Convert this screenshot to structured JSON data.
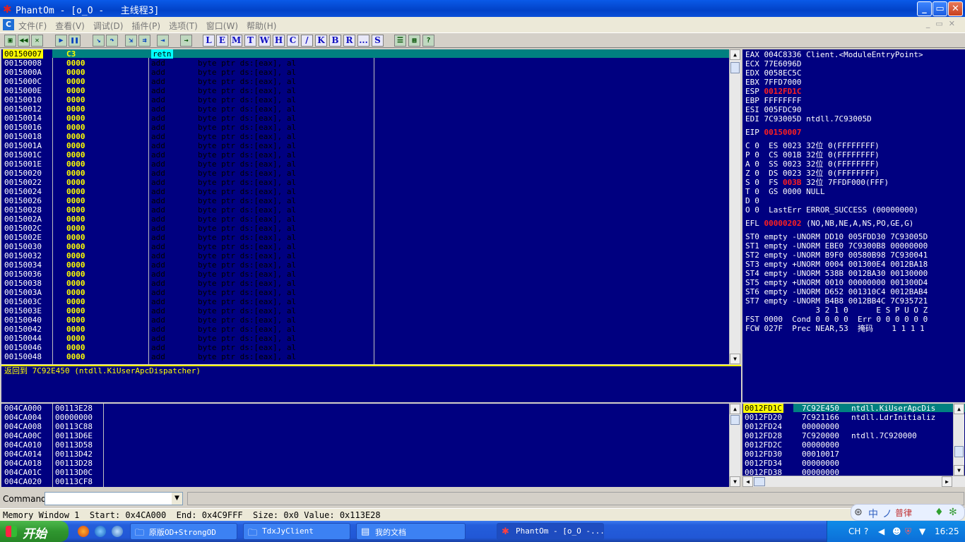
{
  "window": {
    "title": "PhantOm - [o_O -   主线程3]",
    "controls": [
      "_",
      "▭",
      "✕"
    ]
  },
  "menu": {
    "items": [
      "文件(F)",
      "查看(V)",
      "调试(D)",
      "插件(P)",
      "选项(T)",
      "窗口(W)",
      "帮助(H)"
    ]
  },
  "toolbar": {
    "letters": [
      "L",
      "E",
      "M",
      "T",
      "W",
      "H",
      "C",
      "/",
      "K",
      "B",
      "R",
      "...",
      "S"
    ]
  },
  "disasm": {
    "rows": [
      {
        "addr": "00150007",
        "hex": "C3",
        "mnemonic": "retn",
        "operand": ""
      },
      {
        "addr": "00150008",
        "hex": "0000",
        "mnemonic": "add",
        "operand": "byte ptr ds:[eax], al"
      },
      {
        "addr": "0015000A",
        "hex": "0000",
        "mnemonic": "add",
        "operand": "byte ptr ds:[eax], al"
      },
      {
        "addr": "0015000C",
        "hex": "0000",
        "mnemonic": "add",
        "operand": "byte ptr ds:[eax], al"
      },
      {
        "addr": "0015000E",
        "hex": "0000",
        "mnemonic": "add",
        "operand": "byte ptr ds:[eax], al"
      },
      {
        "addr": "00150010",
        "hex": "0000",
        "mnemonic": "add",
        "operand": "byte ptr ds:[eax], al"
      },
      {
        "addr": "00150012",
        "hex": "0000",
        "mnemonic": "add",
        "operand": "byte ptr ds:[eax], al"
      },
      {
        "addr": "00150014",
        "hex": "0000",
        "mnemonic": "add",
        "operand": "byte ptr ds:[eax], al"
      },
      {
        "addr": "00150016",
        "hex": "0000",
        "mnemonic": "add",
        "operand": "byte ptr ds:[eax], al"
      },
      {
        "addr": "00150018",
        "hex": "0000",
        "mnemonic": "add",
        "operand": "byte ptr ds:[eax], al"
      },
      {
        "addr": "0015001A",
        "hex": "0000",
        "mnemonic": "add",
        "operand": "byte ptr ds:[eax], al"
      },
      {
        "addr": "0015001C",
        "hex": "0000",
        "mnemonic": "add",
        "operand": "byte ptr ds:[eax], al"
      },
      {
        "addr": "0015001E",
        "hex": "0000",
        "mnemonic": "add",
        "operand": "byte ptr ds:[eax], al"
      },
      {
        "addr": "00150020",
        "hex": "0000",
        "mnemonic": "add",
        "operand": "byte ptr ds:[eax], al"
      },
      {
        "addr": "00150022",
        "hex": "0000",
        "mnemonic": "add",
        "operand": "byte ptr ds:[eax], al"
      },
      {
        "addr": "00150024",
        "hex": "0000",
        "mnemonic": "add",
        "operand": "byte ptr ds:[eax], al"
      },
      {
        "addr": "00150026",
        "hex": "0000",
        "mnemonic": "add",
        "operand": "byte ptr ds:[eax], al"
      },
      {
        "addr": "00150028",
        "hex": "0000",
        "mnemonic": "add",
        "operand": "byte ptr ds:[eax], al"
      },
      {
        "addr": "0015002A",
        "hex": "0000",
        "mnemonic": "add",
        "operand": "byte ptr ds:[eax], al"
      },
      {
        "addr": "0015002C",
        "hex": "0000",
        "mnemonic": "add",
        "operand": "byte ptr ds:[eax], al"
      },
      {
        "addr": "0015002E",
        "hex": "0000",
        "mnemonic": "add",
        "operand": "byte ptr ds:[eax], al"
      },
      {
        "addr": "00150030",
        "hex": "0000",
        "mnemonic": "add",
        "operand": "byte ptr ds:[eax], al"
      },
      {
        "addr": "00150032",
        "hex": "0000",
        "mnemonic": "add",
        "operand": "byte ptr ds:[eax], al"
      },
      {
        "addr": "00150034",
        "hex": "0000",
        "mnemonic": "add",
        "operand": "byte ptr ds:[eax], al"
      },
      {
        "addr": "00150036",
        "hex": "0000",
        "mnemonic": "add",
        "operand": "byte ptr ds:[eax], al"
      },
      {
        "addr": "00150038",
        "hex": "0000",
        "mnemonic": "add",
        "operand": "byte ptr ds:[eax], al"
      },
      {
        "addr": "0015003A",
        "hex": "0000",
        "mnemonic": "add",
        "operand": "byte ptr ds:[eax], al"
      },
      {
        "addr": "0015003C",
        "hex": "0000",
        "mnemonic": "add",
        "operand": "byte ptr ds:[eax], al"
      },
      {
        "addr": "0015003E",
        "hex": "0000",
        "mnemonic": "add",
        "operand": "byte ptr ds:[eax], al"
      },
      {
        "addr": "00150040",
        "hex": "0000",
        "mnemonic": "add",
        "operand": "byte ptr ds:[eax], al"
      },
      {
        "addr": "00150042",
        "hex": "0000",
        "mnemonic": "add",
        "operand": "byte ptr ds:[eax], al"
      },
      {
        "addr": "00150044",
        "hex": "0000",
        "mnemonic": "add",
        "operand": "byte ptr ds:[eax], al"
      },
      {
        "addr": "00150046",
        "hex": "0000",
        "mnemonic": "add",
        "operand": "byte ptr ds:[eax], al"
      },
      {
        "addr": "00150048",
        "hex": "0000",
        "mnemonic": "add",
        "operand": "byte ptr ds:[eax], al"
      }
    ]
  },
  "info": {
    "text": "返回到 7C92E450 (ntdll.KiUserApcDispatcher)"
  },
  "registers": {
    "lines": [
      {
        "t": "EAX 004C8336 Client.<ModuleEntryPoint>",
        "hl": ""
      },
      {
        "t": "ECX 77E6096D",
        "hl": ""
      },
      {
        "t": "EDX 0058EC5C",
        "hl": ""
      },
      {
        "t": "EBX 7FFD7000",
        "hl": ""
      },
      {
        "t": "ESP ",
        "hl": "0012FD1C"
      },
      {
        "t": "EBP FFFFFFFF",
        "hl": ""
      },
      {
        "t": "ESI 005FDC90",
        "hl": ""
      },
      {
        "t": "EDI 7C93005D ntdll.7C93005D",
        "hl": ""
      },
      {
        "t": "",
        "hl": ""
      },
      {
        "t": "EIP ",
        "hl": "00150007"
      },
      {
        "t": "",
        "hl": ""
      },
      {
        "t": "C 0  ES 0023 32位 0(FFFFFFFF)",
        "hl": ""
      },
      {
        "t": "P 0  CS 001B 32位 0(FFFFFFFF)",
        "hl": ""
      },
      {
        "t": "A 0  SS 0023 32位 0(FFFFFFFF)",
        "hl": ""
      },
      {
        "t": "Z 0  DS 0023 32位 0(FFFFFFFF)",
        "hl": ""
      },
      {
        "t": "S 0  FS ",
        "hl": "003B",
        "after": " 32位 7FFDF000(FFF)"
      },
      {
        "t": "T 0  GS 0000 NULL",
        "hl": ""
      },
      {
        "t": "D 0",
        "hl": ""
      },
      {
        "t": "O 0  LastErr ERROR_SUCCESS (00000000)",
        "hl": ""
      },
      {
        "t": "",
        "hl": ""
      },
      {
        "t": "EFL ",
        "hl": "00000202",
        "after": " (NO,NB,NE,A,NS,PO,GE,G)"
      },
      {
        "t": "",
        "hl": ""
      },
      {
        "t": "ST0 empty -UNORM DD10 005FDD30 7C93005D",
        "hl": ""
      },
      {
        "t": "ST1 empty -UNORM EBE0 7C9300B8 00000000",
        "hl": ""
      },
      {
        "t": "ST2 empty -UNORM B9F0 00580B98 7C930041",
        "hl": ""
      },
      {
        "t": "ST3 empty +UNORM 0004 001300E4 0012BA18",
        "hl": ""
      },
      {
        "t": "ST4 empty -UNORM 538B 0012BA30 00130000",
        "hl": ""
      },
      {
        "t": "ST5 empty +UNORM 0010 00000000 001300D4",
        "hl": ""
      },
      {
        "t": "ST6 empty -UNORM D652 001310C4 0012BAB4",
        "hl": ""
      },
      {
        "t": "ST7 empty -UNORM B4B8 0012BB4C 7C935721",
        "hl": ""
      },
      {
        "t": "               3 2 1 0      E S P U O Z",
        "hl": ""
      },
      {
        "t": "FST 0000  Cond 0 0 0 0  Err 0 0 0 0 0 0",
        "hl": ""
      },
      {
        "t": "FCW 027F  Prec NEAR,53  掩码    1 1 1 1",
        "hl": ""
      }
    ]
  },
  "dump": {
    "rows": [
      {
        "addr": "004CA000",
        "val": "00113E28"
      },
      {
        "addr": "004CA004",
        "val": "00000000"
      },
      {
        "addr": "004CA008",
        "val": "00113C88"
      },
      {
        "addr": "004CA00C",
        "val": "00113D6E"
      },
      {
        "addr": "004CA010",
        "val": "00113D58"
      },
      {
        "addr": "004CA014",
        "val": "00113D42"
      },
      {
        "addr": "004CA018",
        "val": "00113D28"
      },
      {
        "addr": "004CA01C",
        "val": "00113D0C"
      },
      {
        "addr": "004CA020",
        "val": "00113CF8"
      }
    ]
  },
  "stack": {
    "rows": [
      {
        "addr": "0012FD1C",
        "val": "7C92E450",
        "cmt": "ntdll.KiUserApcDis"
      },
      {
        "addr": "0012FD20",
        "val": "7C921166",
        "cmt": "ntdll.LdrInitializ"
      },
      {
        "addr": "0012FD24",
        "val": "00000000",
        "cmt": ""
      },
      {
        "addr": "0012FD28",
        "val": "7C920000",
        "cmt": "ntdll.7C920000"
      },
      {
        "addr": "0012FD2C",
        "val": "00000000",
        "cmt": ""
      },
      {
        "addr": "0012FD30",
        "val": "00010017",
        "cmt": ""
      },
      {
        "addr": "0012FD34",
        "val": "00000000",
        "cmt": ""
      },
      {
        "addr": "0012FD38",
        "val": "00000000",
        "cmt": ""
      }
    ]
  },
  "command": {
    "label": "Command",
    "value": ""
  },
  "status": {
    "text": "Memory Window 1  Start: 0x4CA000  End: 0x4C9FFF  Size: 0x0 Value: 0x113E28"
  },
  "ime": {
    "chars": [
      "中",
      "ノ",
      "普律"
    ]
  },
  "taskbar": {
    "start": "开始",
    "tasks": [
      {
        "label": "原版OD+StrongOD",
        "icon": "folder-icon"
      },
      {
        "label": "TdxJyClient",
        "icon": "folder-icon"
      },
      {
        "label": "我的文档",
        "icon": "document-icon"
      },
      {
        "label": "PhantOm - [o_O -...",
        "icon": "ollydbg-icon"
      }
    ],
    "tray_lang": "CH",
    "clock": "16:25"
  }
}
